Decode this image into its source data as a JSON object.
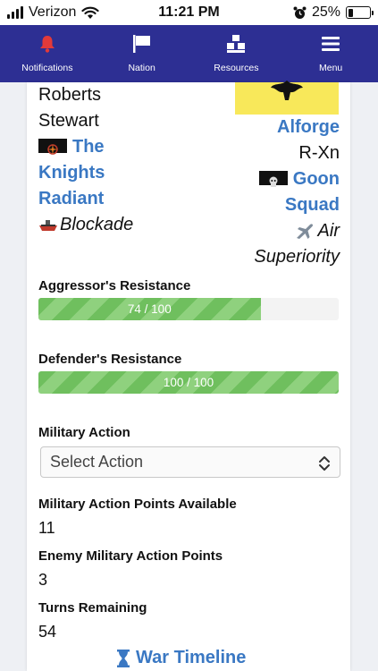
{
  "status_bar": {
    "carrier": "Verizon",
    "time": "11:21 PM",
    "battery": "25%",
    "battery_level": 0.25
  },
  "nav": {
    "items": [
      {
        "label": "Notifications",
        "icon": "bell-icon"
      },
      {
        "label": "Nation",
        "icon": "flag-icon"
      },
      {
        "label": "Resources",
        "icon": "resources-icon"
      },
      {
        "label": "Menu",
        "icon": "hamburger-icon"
      }
    ]
  },
  "attacker": {
    "name_line1": "Roberts",
    "name_line2": "Stewart",
    "alliance_line1": "The",
    "alliance_line2": "Knights",
    "alliance_line3": "Radiant",
    "status": "Blockade"
  },
  "defender": {
    "name": "Alforge",
    "leader": "R-Xn",
    "alliance_line1": "Goon",
    "alliance_line2": "Squad",
    "status_line1": "Air",
    "status_line2": "Superiority"
  },
  "aggressor_resistance": {
    "label": "Aggressor's Resistance",
    "text": "74 / 100",
    "value": 74,
    "max": 100
  },
  "defender_resistance": {
    "label": "Defender's Resistance",
    "text": "100 / 100",
    "value": 100,
    "max": 100
  },
  "military_action": {
    "label": "Military Action",
    "placeholder": "Select Action"
  },
  "map_available": {
    "label": "Military Action Points Available",
    "value": "11"
  },
  "enemy_map": {
    "label": "Enemy Military Action Points",
    "value": "3"
  },
  "turns": {
    "label": "Turns Remaining",
    "value": "54"
  },
  "timeline": {
    "label": "War Timeline"
  },
  "colors": {
    "nav_bg": "#2d2f93",
    "link": "#3a78c3",
    "bar_green": "#6fbf5e",
    "flag_yellow": "#f8e85a",
    "bell_red": "#e23a3a"
  }
}
